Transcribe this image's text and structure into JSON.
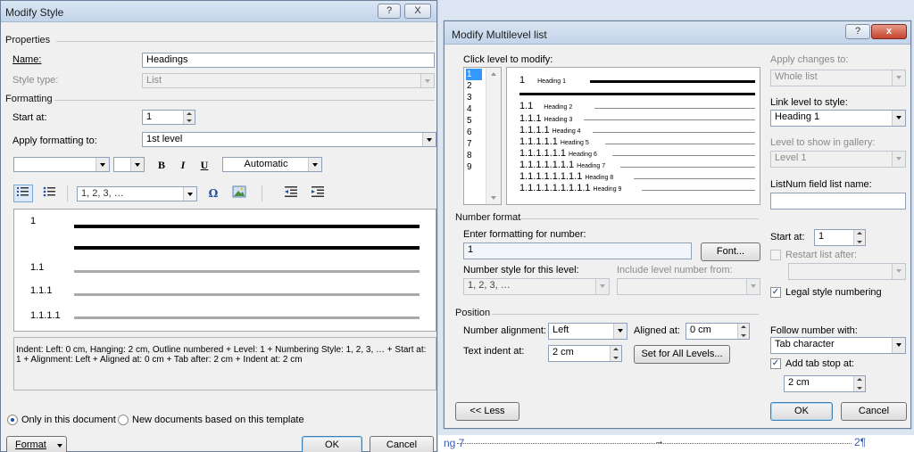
{
  "background": {
    "link_text": "ng 7",
    "arrow": "→",
    "page_number": "2¶"
  },
  "modify_style": {
    "title": "Modify Style",
    "help_label": "?",
    "close_label": "X",
    "sections": {
      "properties": "Properties",
      "formatting": "Formatting"
    },
    "name_label": "Name:",
    "name_value": "Headings",
    "style_type_label": "Style type:",
    "style_type_value": "List",
    "start_at_label": "Start at:",
    "start_at_value": "1",
    "apply_to_label": "Apply formatting to:",
    "apply_to_value": "1st level",
    "font_value": "",
    "size_value": "",
    "bold": "B",
    "italic": "I",
    "underline": "U",
    "color_value": "Automatic",
    "number_style_value": "1, 2, 3, …",
    "omega": "Ω",
    "preview_levels": [
      "1",
      "1.1",
      "1.1.1",
      "1.1.1.1"
    ],
    "description": "Indent: Left:  0 cm, Hanging:  2 cm, Outline numbered + Level: 1 + Numbering Style: 1, 2, 3, … + Start at: 1 + Alignment: Left + Aligned at:  0 cm + Tab after:  2 cm + Indent at:  2 cm",
    "only_this_doc": "Only in this document",
    "new_docs": "New documents based on this template",
    "format_btn": "Format",
    "ok_btn": "OK",
    "cancel_btn": "Cancel"
  },
  "modify_multilevel": {
    "title": "Modify Multilevel list",
    "help_label": "?",
    "close_label": "x",
    "click_level_label": "Click level to modify:",
    "levels": [
      "1",
      "2",
      "3",
      "4",
      "5",
      "6",
      "7",
      "8",
      "9"
    ],
    "selected_level": "1",
    "preview": [
      {
        "num": "1",
        "heading": "Heading 1"
      },
      {
        "num": "1.1",
        "heading": "Heading 2"
      },
      {
        "num": "1.1.1",
        "heading": "Heading 3"
      },
      {
        "num": "1.1.1.1",
        "heading": "Heading 4"
      },
      {
        "num": "1.1.1.1.1",
        "heading": "Heading 5"
      },
      {
        "num": "1.1.1.1.1.1",
        "heading": "Heading 6"
      },
      {
        "num": "1.1.1.1.1.1.1",
        "heading": "Heading 7"
      },
      {
        "num": "1.1.1.1.1.1.1.1",
        "heading": "Heading 8"
      },
      {
        "num": "1.1.1.1.1.1.1.1.1",
        "heading": "Heading 9"
      }
    ],
    "apply_changes_label": "Apply changes to:",
    "apply_changes_value": "Whole list",
    "link_level_label": "Link level to style:",
    "link_level_value": "Heading 1",
    "gallery_label": "Level to show in gallery:",
    "gallery_value": "Level 1",
    "listnum_label": "ListNum field list name:",
    "listnum_value": "",
    "number_format_section": "Number format",
    "enter_format_label": "Enter formatting for number:",
    "format_value": "1",
    "font_btn": "Font...",
    "number_style_label": "Number style for this level:",
    "number_style_value": "1, 2, 3, …",
    "include_level_label": "Include level number from:",
    "include_level_value": "",
    "start_at_label": "Start at:",
    "start_at_value": "1",
    "restart_label": "Restart list after:",
    "restart_value": "",
    "legal_label": "Legal style numbering",
    "position_section": "Position",
    "alignment_label": "Number alignment:",
    "alignment_value": "Left",
    "aligned_at_label": "Aligned at:",
    "aligned_at_value": "0 cm",
    "text_indent_label": "Text indent at:",
    "text_indent_value": "2 cm",
    "set_all_btn": "Set for All Levels...",
    "follow_label": "Follow number with:",
    "follow_value": "Tab character",
    "add_tab_label": "Add tab stop at:",
    "tab_value": "2 cm",
    "less_btn": "<< Less",
    "ok_btn": "OK",
    "cancel_btn": "Cancel"
  }
}
